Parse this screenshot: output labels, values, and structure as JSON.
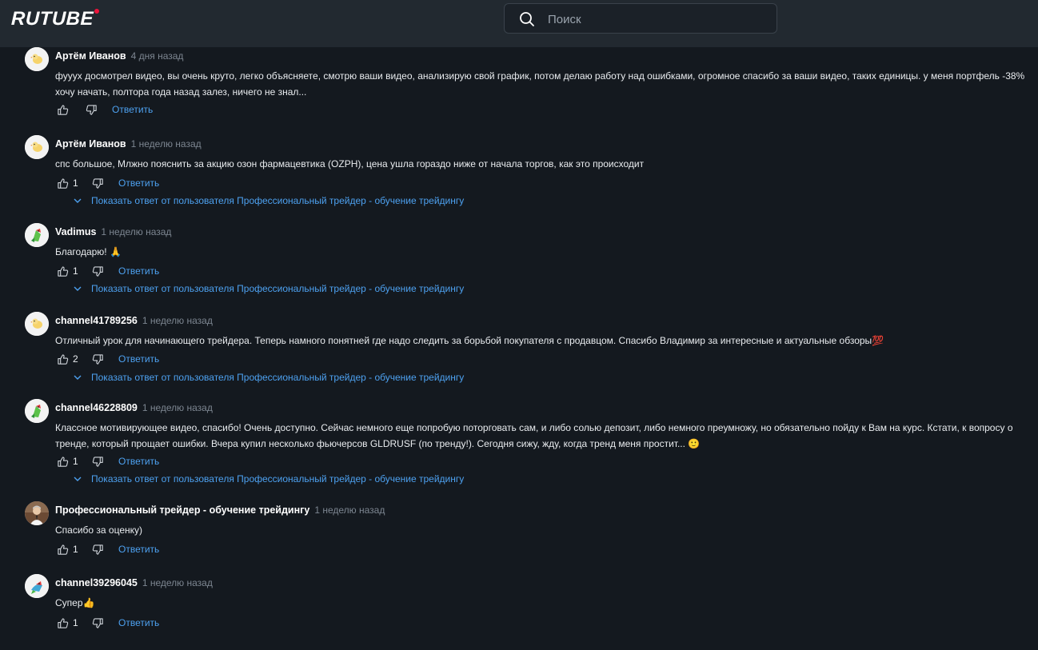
{
  "header": {
    "logo_text": "RUTUBE",
    "logo_dot_color": "#ed143b",
    "search_placeholder": "Поиск"
  },
  "reply_label": "Ответить",
  "comments": [
    {
      "author": "Артём Иванов",
      "time": "4 дня назад",
      "text": "фууух досмотрел видео, вы очень круто, легко объясняете, смотрю ваши видео, анализирую свой график, потом делаю работу над ошибками, огромное спасибо за ваши видео, таких единицы.  у меня портфель -38% хочу начать, полтора года назад залез, ничего не знал...",
      "likes": "",
      "show_replies": "",
      "avatar": "chick-icon"
    },
    {
      "author": "Артём Иванов",
      "time": "1 неделю назад",
      "text": "спс большое, Млжно пояснить за акцию озон фармацевтика (OZPH), цена ушла гораздо ниже от начала торгов, как это происходит",
      "likes": "1",
      "show_replies": "Показать ответ от пользователя Профессиональный трейдер - обучение трейдингу",
      "avatar": "chick-icon"
    },
    {
      "author": "Vadimus",
      "time": "1 неделю назад",
      "text": "Благодарю! 🙏",
      "likes": "1",
      "show_replies": "Показать ответ от пользователя Профессиональный трейдер - обучение трейдингу",
      "avatar": "parrot-icon"
    },
    {
      "author": "channel41789256",
      "time": "1 неделю назад",
      "text": "Отличный урок для начинающего трейдера. Теперь намного понятней где надо следить за борьбой покупателя с продавцом. Спасибо Владимир за интересные и актуальные обзоры💯",
      "likes": "2",
      "show_replies": "Показать ответ от пользователя Профессиональный трейдер - обучение трейдингу",
      "avatar": "chick-icon"
    },
    {
      "author": "channel46228809",
      "time": "1 неделю назад",
      "text": "Классное мотивирующее видео, спасибо! Очень доступно. Сейчас немного еще попробую поторговать сам, и либо солью депозит, либо немного преумножу, но обязательно пойду к Вам на курс. Кстати, к вопросу о тренде, который прощает ошибки. Вчера купил несколько фьючерсов GLDRUSF (по тренду!). Сегодня сижу, жду, когда тренд меня простит... 🙂",
      "likes": "1",
      "show_replies": "Показать ответ от пользователя Профессиональный трейдер - обучение трейдингу",
      "avatar": "parrot-icon"
    },
    {
      "author": "Профессиональный трейдер - обучение трейдингу",
      "time": "1 неделю назад",
      "text": "Спасибо за оценку)",
      "likes": "1",
      "show_replies": "",
      "avatar": "person-photo-icon"
    },
    {
      "author": "channel39296045",
      "time": "1 неделю назад",
      "text": "Супер👍",
      "likes": "1",
      "show_replies": "",
      "avatar": "bird-icon"
    }
  ]
}
